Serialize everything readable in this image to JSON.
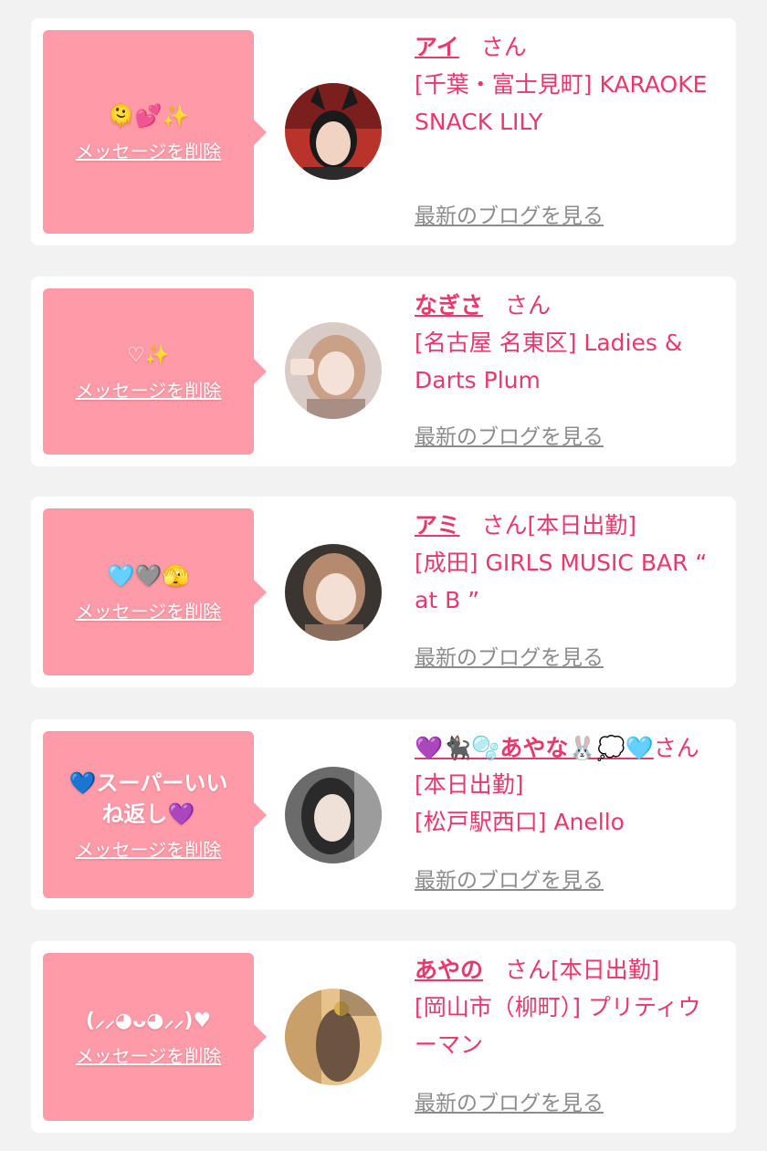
{
  "common": {
    "delete_label": "メッセージを削除",
    "blog_label": "最新のブログを見る",
    "san_label": "さん"
  },
  "cards": [
    {
      "message": "🫠💕✨",
      "name": "アイ",
      "status": "",
      "shop": "[千葉・富士見町] KARAOKE SNACK LILY",
      "avatar_colors": [
        "#7a1e1e",
        "#c23a2e",
        "#f1d3c2",
        "#1a1a1a"
      ]
    },
    {
      "message": "♡✨",
      "name": "なぎさ",
      "status": "",
      "shop": "[名古屋 名東区] Ladies & Darts Plum",
      "avatar_colors": [
        "#d9cbc6",
        "#a88f86",
        "#f4e2d9",
        "#caa087"
      ]
    },
    {
      "message": "🩵🩶🫣",
      "name": "アミ",
      "status": "[本日出勤]",
      "shop": "[成田] GIRLS MUSIC BAR “ at B ”",
      "avatar_colors": [
        "#3b3532",
        "#8a6d5c",
        "#f3dfd3",
        "#b68a6f"
      ]
    },
    {
      "message": "💙スーパーいいね返し💜",
      "name": "💜🐈‍⬛🫧あやな🐰💭🩵",
      "status": "[本日出勤]",
      "shop": "[松戸駅西口] Anello",
      "avatar_colors": [
        "#6b6b6b",
        "#2a2a2a",
        "#efe1d8",
        "#9c9c9c"
      ]
    },
    {
      "message": "(⸝⸝◕ᴗ◕⸝⸝)♥",
      "name": "あやの",
      "status": "[本日出勤]",
      "shop": "[岡山市（柳町）] プリティウーマン",
      "avatar_colors": [
        "#6b5540",
        "#c9a06a",
        "#e8c28d",
        "#3a2d22"
      ]
    }
  ]
}
